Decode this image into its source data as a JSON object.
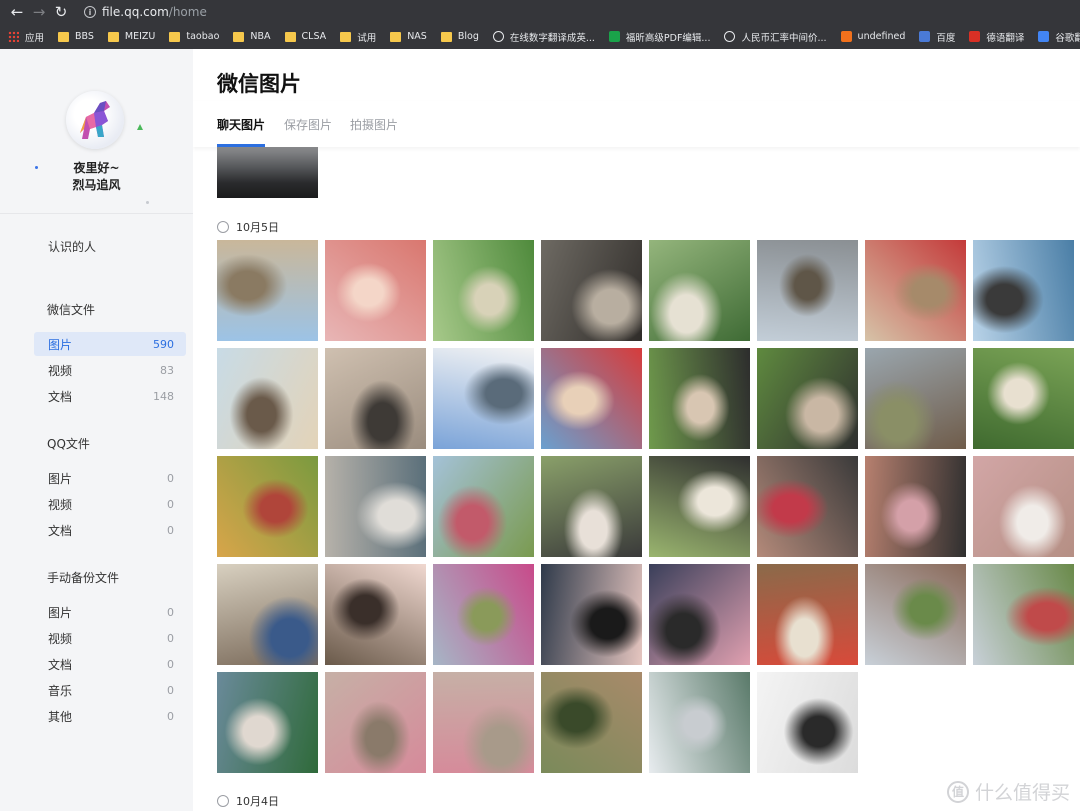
{
  "browser": {
    "url_host": "file.qq.com",
    "url_path": "/home",
    "bookmarks": [
      {
        "label": "应用",
        "icon": "apps-grid-icon"
      },
      {
        "label": "BBS",
        "icon": "folder-icon"
      },
      {
        "label": "MEIZU",
        "icon": "folder-icon"
      },
      {
        "label": "taobao",
        "icon": "folder-icon"
      },
      {
        "label": "NBA",
        "icon": "folder-icon"
      },
      {
        "label": "CLSA",
        "icon": "folder-icon"
      },
      {
        "label": "试用",
        "icon": "folder-icon"
      },
      {
        "label": "NAS",
        "icon": "folder-icon"
      },
      {
        "label": "Blog",
        "icon": "folder-icon"
      },
      {
        "label": "在线数字翻译成英...",
        "icon": "globe-icon"
      },
      {
        "label": "福昕高级PDF编辑...",
        "icon": "foxit-icon"
      },
      {
        "label": "人民币汇率中间价...",
        "icon": "globe-icon"
      },
      {
        "label": "undefined",
        "icon": "orange-site-icon"
      },
      {
        "label": "百度",
        "icon": "baidu-icon"
      },
      {
        "label": "德语翻译",
        "icon": "red-site-icon"
      },
      {
        "label": "谷歌翻译",
        "icon": "google-translate-icon"
      }
    ]
  },
  "profile": {
    "nickname_line1": "夜里好~",
    "nickname_line2": "烈马追风",
    "avatar_icon": "horse-avatar-icon"
  },
  "sidebar": {
    "known_people": "认识的人",
    "sections": [
      {
        "title": "微信文件",
        "items": [
          {
            "label": "图片",
            "count": "590",
            "active": true
          },
          {
            "label": "视频",
            "count": "83"
          },
          {
            "label": "文档",
            "count": "148"
          }
        ]
      },
      {
        "title": "QQ文件",
        "items": [
          {
            "label": "图片",
            "count": "0"
          },
          {
            "label": "视频",
            "count": "0"
          },
          {
            "label": "文档",
            "count": "0"
          }
        ]
      },
      {
        "title": "手动备份文件",
        "items": [
          {
            "label": "图片",
            "count": "0"
          },
          {
            "label": "视频",
            "count": "0"
          },
          {
            "label": "文档",
            "count": "0"
          },
          {
            "label": "音乐",
            "count": "0"
          },
          {
            "label": "其他",
            "count": "0"
          }
        ]
      }
    ]
  },
  "main": {
    "title": "微信图片",
    "tabs": [
      "聊天图片",
      "保存图片",
      "拍摄图片"
    ],
    "groups": [
      {
        "date": "10月5日",
        "photo_count": 38
      },
      {
        "date": "10月4日"
      }
    ]
  },
  "watermark": "什么值得买",
  "colors": {
    "accent": "#2c6fe0",
    "sidebar_bg": "#f4f5f7",
    "active_item_bg": "#dfe8f8",
    "chrome_bg": "#35363a"
  }
}
